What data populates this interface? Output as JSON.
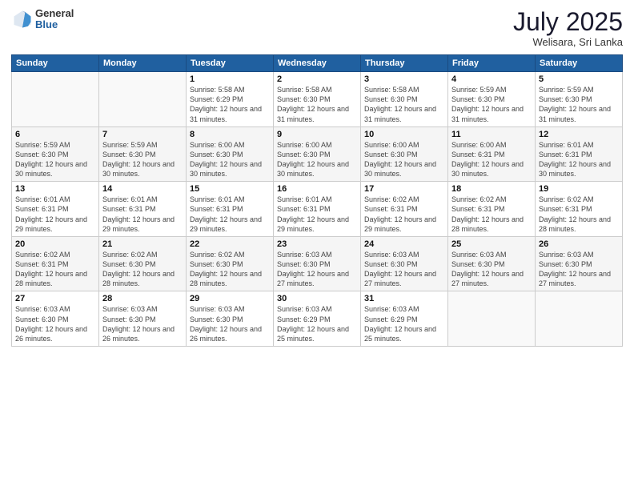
{
  "header": {
    "logo": {
      "general": "General",
      "blue": "Blue"
    },
    "title": "July 2025",
    "location": "Welisara, Sri Lanka"
  },
  "weekdays": [
    "Sunday",
    "Monday",
    "Tuesday",
    "Wednesday",
    "Thursday",
    "Friday",
    "Saturday"
  ],
  "weeks": [
    [
      {
        "day": "",
        "info": ""
      },
      {
        "day": "",
        "info": ""
      },
      {
        "day": "1",
        "info": "Sunrise: 5:58 AM\nSunset: 6:29 PM\nDaylight: 12 hours and 31 minutes."
      },
      {
        "day": "2",
        "info": "Sunrise: 5:58 AM\nSunset: 6:30 PM\nDaylight: 12 hours and 31 minutes."
      },
      {
        "day": "3",
        "info": "Sunrise: 5:58 AM\nSunset: 6:30 PM\nDaylight: 12 hours and 31 minutes."
      },
      {
        "day": "4",
        "info": "Sunrise: 5:59 AM\nSunset: 6:30 PM\nDaylight: 12 hours and 31 minutes."
      },
      {
        "day": "5",
        "info": "Sunrise: 5:59 AM\nSunset: 6:30 PM\nDaylight: 12 hours and 31 minutes."
      }
    ],
    [
      {
        "day": "6",
        "info": "Sunrise: 5:59 AM\nSunset: 6:30 PM\nDaylight: 12 hours and 30 minutes."
      },
      {
        "day": "7",
        "info": "Sunrise: 5:59 AM\nSunset: 6:30 PM\nDaylight: 12 hours and 30 minutes."
      },
      {
        "day": "8",
        "info": "Sunrise: 6:00 AM\nSunset: 6:30 PM\nDaylight: 12 hours and 30 minutes."
      },
      {
        "day": "9",
        "info": "Sunrise: 6:00 AM\nSunset: 6:30 PM\nDaylight: 12 hours and 30 minutes."
      },
      {
        "day": "10",
        "info": "Sunrise: 6:00 AM\nSunset: 6:30 PM\nDaylight: 12 hours and 30 minutes."
      },
      {
        "day": "11",
        "info": "Sunrise: 6:00 AM\nSunset: 6:31 PM\nDaylight: 12 hours and 30 minutes."
      },
      {
        "day": "12",
        "info": "Sunrise: 6:01 AM\nSunset: 6:31 PM\nDaylight: 12 hours and 30 minutes."
      }
    ],
    [
      {
        "day": "13",
        "info": "Sunrise: 6:01 AM\nSunset: 6:31 PM\nDaylight: 12 hours and 29 minutes."
      },
      {
        "day": "14",
        "info": "Sunrise: 6:01 AM\nSunset: 6:31 PM\nDaylight: 12 hours and 29 minutes."
      },
      {
        "day": "15",
        "info": "Sunrise: 6:01 AM\nSunset: 6:31 PM\nDaylight: 12 hours and 29 minutes."
      },
      {
        "day": "16",
        "info": "Sunrise: 6:01 AM\nSunset: 6:31 PM\nDaylight: 12 hours and 29 minutes."
      },
      {
        "day": "17",
        "info": "Sunrise: 6:02 AM\nSunset: 6:31 PM\nDaylight: 12 hours and 29 minutes."
      },
      {
        "day": "18",
        "info": "Sunrise: 6:02 AM\nSunset: 6:31 PM\nDaylight: 12 hours and 28 minutes."
      },
      {
        "day": "19",
        "info": "Sunrise: 6:02 AM\nSunset: 6:31 PM\nDaylight: 12 hours and 28 minutes."
      }
    ],
    [
      {
        "day": "20",
        "info": "Sunrise: 6:02 AM\nSunset: 6:31 PM\nDaylight: 12 hours and 28 minutes."
      },
      {
        "day": "21",
        "info": "Sunrise: 6:02 AM\nSunset: 6:30 PM\nDaylight: 12 hours and 28 minutes."
      },
      {
        "day": "22",
        "info": "Sunrise: 6:02 AM\nSunset: 6:30 PM\nDaylight: 12 hours and 28 minutes."
      },
      {
        "day": "23",
        "info": "Sunrise: 6:03 AM\nSunset: 6:30 PM\nDaylight: 12 hours and 27 minutes."
      },
      {
        "day": "24",
        "info": "Sunrise: 6:03 AM\nSunset: 6:30 PM\nDaylight: 12 hours and 27 minutes."
      },
      {
        "day": "25",
        "info": "Sunrise: 6:03 AM\nSunset: 6:30 PM\nDaylight: 12 hours and 27 minutes."
      },
      {
        "day": "26",
        "info": "Sunrise: 6:03 AM\nSunset: 6:30 PM\nDaylight: 12 hours and 27 minutes."
      }
    ],
    [
      {
        "day": "27",
        "info": "Sunrise: 6:03 AM\nSunset: 6:30 PM\nDaylight: 12 hours and 26 minutes."
      },
      {
        "day": "28",
        "info": "Sunrise: 6:03 AM\nSunset: 6:30 PM\nDaylight: 12 hours and 26 minutes."
      },
      {
        "day": "29",
        "info": "Sunrise: 6:03 AM\nSunset: 6:30 PM\nDaylight: 12 hours and 26 minutes."
      },
      {
        "day": "30",
        "info": "Sunrise: 6:03 AM\nSunset: 6:29 PM\nDaylight: 12 hours and 25 minutes."
      },
      {
        "day": "31",
        "info": "Sunrise: 6:03 AM\nSunset: 6:29 PM\nDaylight: 12 hours and 25 minutes."
      },
      {
        "day": "",
        "info": ""
      },
      {
        "day": "",
        "info": ""
      }
    ]
  ]
}
